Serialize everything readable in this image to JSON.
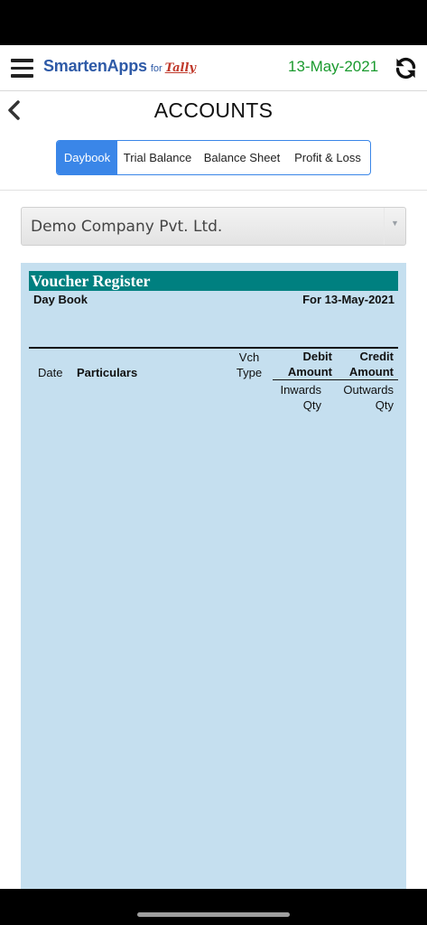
{
  "header": {
    "brand_name": "SmartenApps",
    "brand_for": "for",
    "brand_tally": "Tally",
    "date": "13-May-2021"
  },
  "page": {
    "title": "ACCOUNTS"
  },
  "tabs": [
    {
      "label": "Daybook",
      "active": true
    },
    {
      "label": "Trial Balance",
      "active": false
    },
    {
      "label": "Balance Sheet",
      "active": false
    },
    {
      "label": "Profit & Loss",
      "active": false
    }
  ],
  "company_select": {
    "selected": "Demo Company Pvt. Ltd."
  },
  "report": {
    "title": "Voucher Register",
    "left_heading": "Day Book",
    "right_heading": "For 13-May-2021",
    "columns": {
      "date": "Date",
      "particulars": "Particulars",
      "vch_type": "Vch Type",
      "debit_amount": "Debit Amount",
      "credit_amount": "Credit Amount",
      "inwards_qty": "Inwards Qty",
      "outwards_qty": "Outwards Qty"
    }
  },
  "colors": {
    "brand_blue": "#2e5aa7",
    "date_green": "#1a9a2e",
    "tab_active": "#3a86e8",
    "report_bg": "#c5dfef",
    "report_title_bg": "#008080"
  },
  "icons": {
    "menu": "hamburger-menu-icon",
    "refresh": "refresh-icon",
    "back": "back-chevron-icon",
    "dropdown": "dropdown-caret-icon"
  }
}
